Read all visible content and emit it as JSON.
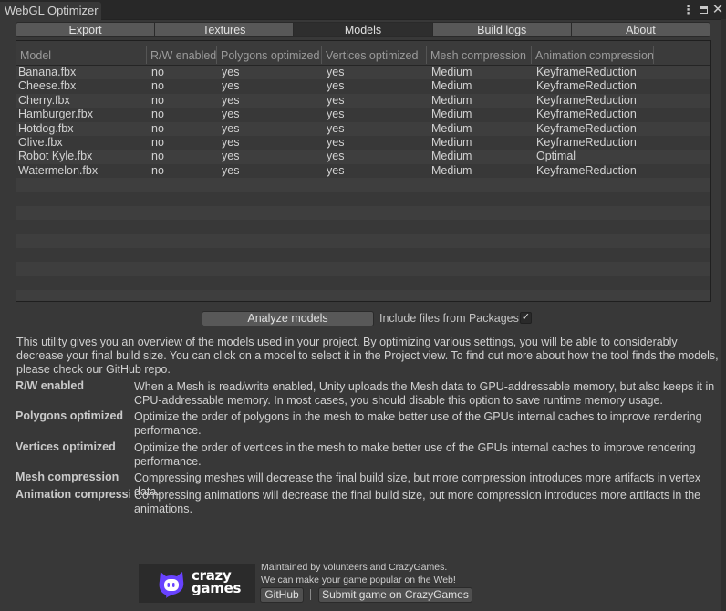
{
  "window": {
    "title": "WebGL Optimizer",
    "controls": {
      "more": "⋮",
      "maximize": "maximize-icon",
      "close": "✕"
    }
  },
  "toolbar": {
    "tabs": [
      {
        "label": "Export",
        "active": false
      },
      {
        "label": "Textures",
        "active": false
      },
      {
        "label": "Models",
        "active": true
      },
      {
        "label": "Build logs",
        "active": false
      },
      {
        "label": "About",
        "active": false
      }
    ]
  },
  "table": {
    "columns": [
      "Model",
      "R/W enabled",
      "Polygons optimized",
      "Vertices optimized",
      "Mesh compression",
      "Animation compression"
    ],
    "rows": [
      [
        "Banana.fbx",
        "no",
        "yes",
        "yes",
        "Medium",
        "KeyframeReduction"
      ],
      [
        "Cheese.fbx",
        "no",
        "yes",
        "yes",
        "Medium",
        "KeyframeReduction"
      ],
      [
        "Cherry.fbx",
        "no",
        "yes",
        "yes",
        "Medium",
        "KeyframeReduction"
      ],
      [
        "Hamburger.fbx",
        "no",
        "yes",
        "yes",
        "Medium",
        "KeyframeReduction"
      ],
      [
        "Hotdog.fbx",
        "no",
        "yes",
        "yes",
        "Medium",
        "KeyframeReduction"
      ],
      [
        "Olive.fbx",
        "no",
        "yes",
        "yes",
        "Medium",
        "KeyframeReduction"
      ],
      [
        "Robot Kyle.fbx",
        "no",
        "yes",
        "yes",
        "Medium",
        "Optimal"
      ],
      [
        "Watermelon.fbx",
        "no",
        "yes",
        "yes",
        "Medium",
        "KeyframeReduction"
      ]
    ]
  },
  "actions": {
    "analyze_label": "Analyze models",
    "include_packages_label": "Include files from Packages",
    "include_packages_checked": true,
    "check_glyph": "✓"
  },
  "help": {
    "intro": "This utility gives you an overview of the models used in your project. By optimizing various settings, you will be able to considerably decrease your final build size. You can click on a model to select it in the Project view. To find out more about how the tool finds the models, please check our GitHub repo.",
    "definitions": [
      {
        "term": "R/W enabled",
        "desc": "When a Mesh is read/write enabled, Unity uploads the Mesh data to GPU-addressable memory, but also keeps it in CPU-addressable memory. In most cases, you should disable this option to save runtime memory usage."
      },
      {
        "term": "Polygons optimized",
        "desc": "Optimize the order of polygons in the mesh to make better use of the GPUs internal caches to improve rendering performance."
      },
      {
        "term": "Vertices optimized",
        "desc": "Optimize the order of vertices in the mesh to make better use of the GPUs internal caches to improve rendering performance."
      },
      {
        "term": "Mesh compression",
        "desc": "Compressing meshes will decrease the final build size, but more compression introduces more artifacts in vertex data."
      },
      {
        "term": "Animation compression",
        "desc": "Compressing animations will decrease the final build size, but more compression introduces more artifacts in the animations."
      }
    ]
  },
  "footer": {
    "logo_line1": "crazy",
    "logo_line2": "games",
    "brand_color": "#6842ff",
    "line1": "Maintained by volunteers and CrazyGames.",
    "line2": "We can make your game popular on the Web!",
    "github_label": "GitHub",
    "submit_label": "Submit game on CrazyGames"
  }
}
